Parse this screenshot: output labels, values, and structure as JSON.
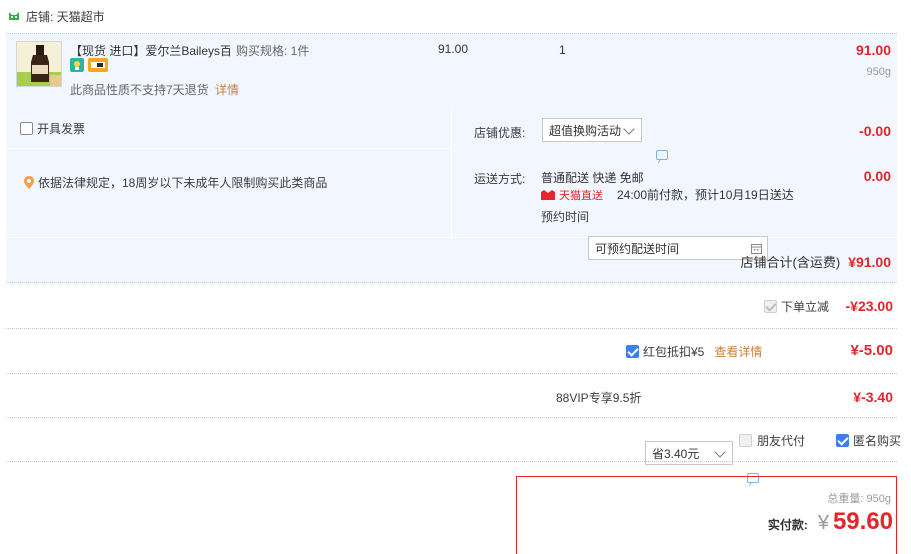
{
  "shop": {
    "label": "店铺: 天猫超市"
  },
  "item": {
    "title": "【现货 进口】爱尔兰Baileys百...",
    "spec": "购买规格: 1件",
    "unit_price": "91.00",
    "quantity": "1",
    "subtotal": "91.00",
    "weight": "950g",
    "notice": "此商品性质不支持7天退货",
    "detail_link": "详情"
  },
  "invoice": {
    "label": "开具发票"
  },
  "age_notice": "依据法律规定，18周岁以下未成年人限制购买此类商品",
  "shop_discount": {
    "label": "店铺优惠:",
    "select_value": "超值换购活动",
    "amount": "-0.00"
  },
  "shipping": {
    "label": "运送方式:",
    "method": "普通配送 快递 免邮",
    "tmall_badge": "天猫直送",
    "eta": "24:00前付款，预计10月19日送达",
    "appointment_label": "预约时间",
    "appointment_placeholder": "可预约配送时间",
    "amount": "0.00"
  },
  "shop_total": {
    "label": "店铺合计(含运费)",
    "amount": "¥91.00"
  },
  "instant_discount": {
    "label": "下单立减",
    "amount": "-¥23.00"
  },
  "red_packet": {
    "label": "红包抵扣¥5",
    "link": "查看详情",
    "amount": "¥-5.00"
  },
  "vip": {
    "label": "88VIP专享9.5折",
    "select_value": "省3.40元",
    "amount": "¥-3.40"
  },
  "options": {
    "friend_pay": "朋友代付",
    "anonymous": "匿名购买"
  },
  "payment": {
    "weight_label": "总重量:",
    "weight": "950g",
    "actual_label": "实付款:",
    "currency": "¥",
    "amount": "59.60"
  },
  "colors": {
    "accent_red": "#e4252a",
    "light_blue_bg": "#f2f7ff",
    "checkbox_blue": "#3d7ef0",
    "link_orange": "#c8803c"
  }
}
